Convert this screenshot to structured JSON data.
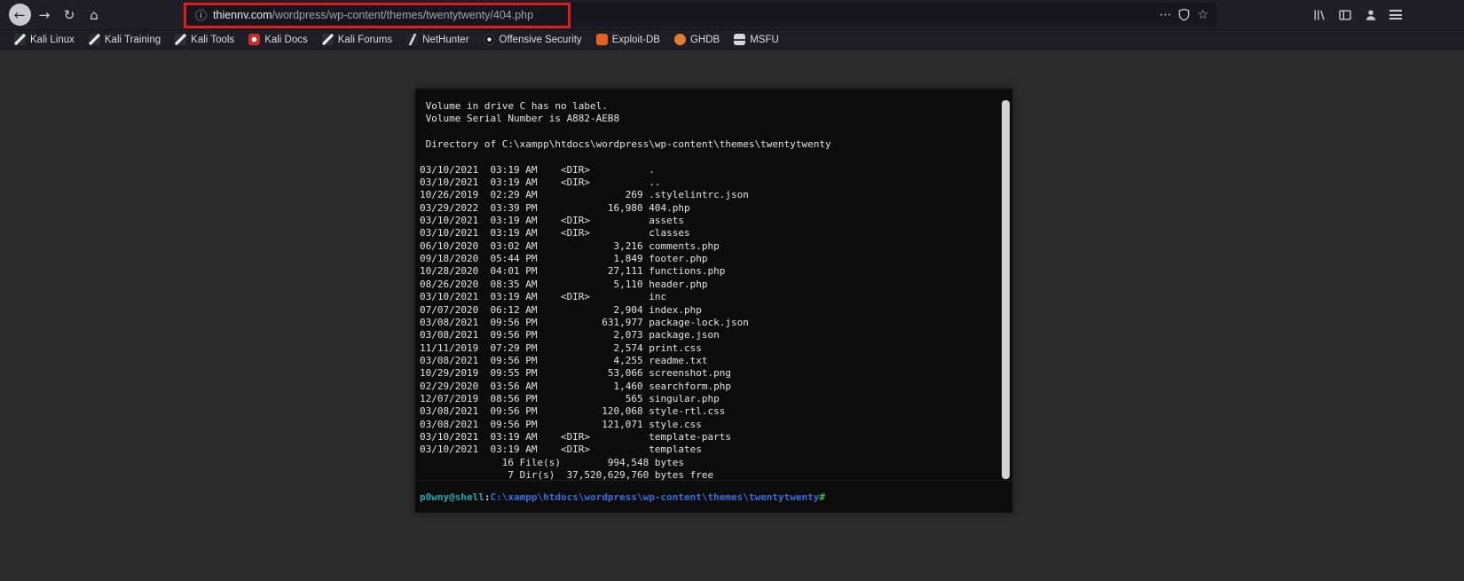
{
  "browser": {
    "icons": {
      "back_arrow": "←",
      "forward_arrow": "→",
      "reload": "↻",
      "home": "⌂",
      "info": "ⓘ",
      "page_actions": "⋯",
      "bookmark_star": "☆"
    },
    "url": {
      "domain": "thiennv.com",
      "path": "/wordpress/wp-content/themes/twentytwenty/404.php"
    },
    "annotation": {
      "color": "#dd1c1c"
    },
    "bookmarks": [
      {
        "label": "Kali Linux"
      },
      {
        "label": "Kali Training"
      },
      {
        "label": "Kali Tools"
      },
      {
        "label": "Kali Docs"
      },
      {
        "label": "Kali Forums"
      },
      {
        "label": "NetHunter"
      },
      {
        "label": "Offensive Security"
      },
      {
        "label": "Exploit-DB"
      },
      {
        "label": "GHDB"
      },
      {
        "label": "MSFU"
      }
    ]
  },
  "shell": {
    "output": " Volume in drive C has no label.\n Volume Serial Number is A882-AEB8\n\n Directory of C:\\xampp\\htdocs\\wordpress\\wp-content\\themes\\twentytwenty\n\n03/10/2021  03:19 AM    <DIR>          .\n03/10/2021  03:19 AM    <DIR>          ..\n10/26/2019  02:29 AM               269 .stylelintrc.json\n03/29/2022  03:39 PM            16,980 404.php\n03/10/2021  03:19 AM    <DIR>          assets\n03/10/2021  03:19 AM    <DIR>          classes\n06/10/2020  03:02 AM             3,216 comments.php\n09/18/2020  05:44 PM             1,849 footer.php\n10/28/2020  04:01 PM            27,111 functions.php\n08/26/2020  08:35 AM             5,110 header.php\n03/10/2021  03:19 AM    <DIR>          inc\n07/07/2020  06:12 AM             2,904 index.php\n03/08/2021  09:56 PM           631,977 package-lock.json\n03/08/2021  09:56 PM             2,073 package.json\n11/11/2019  07:29 PM             2,574 print.css\n03/08/2021  09:56 PM             4,255 readme.txt\n10/29/2019  09:55 PM            53,066 screenshot.png\n02/29/2020  03:56 AM             1,460 searchform.php\n12/07/2019  08:56 PM               565 singular.php\n03/08/2021  09:56 PM           120,068 style-rtl.css\n03/08/2021  09:56 PM           121,071 style.css\n03/10/2021  03:19 AM    <DIR>          template-parts\n03/10/2021  03:19 AM    <DIR>          templates\n              16 File(s)        994,548 bytes\n               7 Dir(s)  37,520,629,760 bytes free",
    "prompt": {
      "user": "p0wny@shell",
      "separator": ":",
      "cwd": "C:\\xampp\\htdocs\\wordpress\\wp-content\\themes\\twentytwenty",
      "symbol": "#"
    },
    "colors": {
      "background": "#0c0c0c",
      "text": "#e4e4e4",
      "prompt_user": "#2aa8ad",
      "prompt_cwd": "#3a6fd8",
      "prompt_symbol": "#46b94a"
    }
  }
}
